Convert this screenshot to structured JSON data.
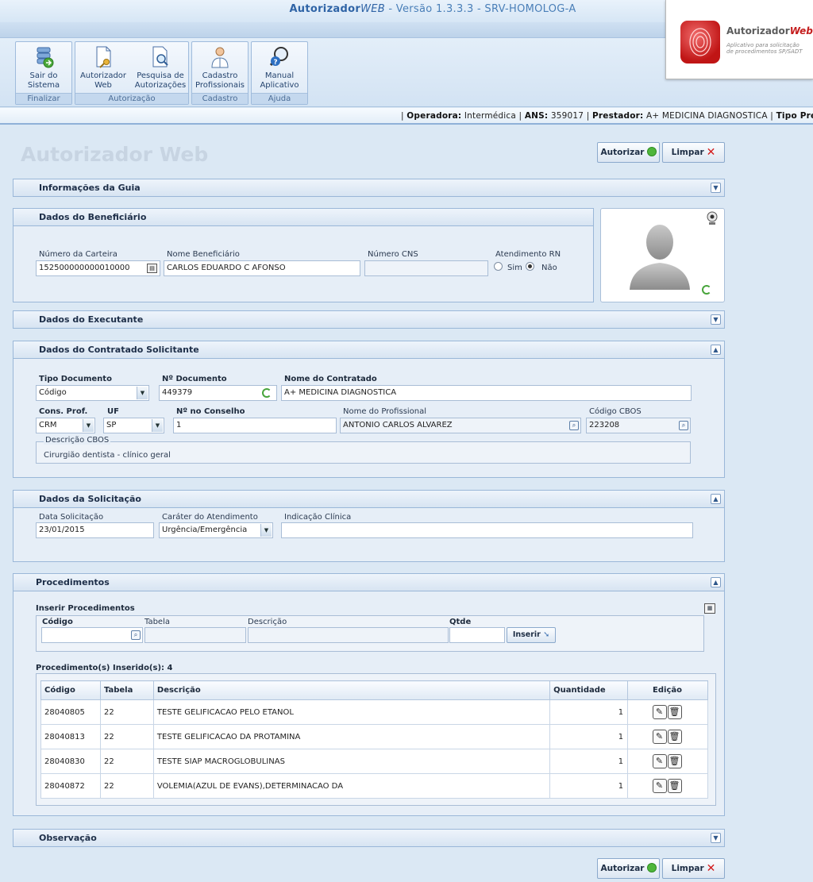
{
  "header": {
    "app_name_bold": "Autorizador",
    "app_name_italic": "WEB",
    "version_text": " - Versão 1.3.3.3 - SRV-HOMOLOG-A"
  },
  "ribbon": {
    "groups": [
      {
        "caption": "Finalizar",
        "buttons": [
          {
            "label": "Sair do Sistema",
            "icon": "exit-system-icon"
          }
        ]
      },
      {
        "caption": "Autorização",
        "buttons": [
          {
            "label": "Autorizador Web",
            "icon": "document-key-icon"
          },
          {
            "label": "Pesquisa de Autorizações",
            "icon": "document-search-icon"
          }
        ]
      },
      {
        "caption": "Cadastro",
        "buttons": [
          {
            "label": "Cadastro Profissionais",
            "icon": "doctor-icon"
          }
        ]
      },
      {
        "caption": "Ajuda",
        "buttons": [
          {
            "label": "Manual Aplicativo",
            "icon": "help-search-icon"
          }
        ]
      }
    ]
  },
  "logo": {
    "name": "Autorizador",
    "name_italic": "Web",
    "tagline": "Aplicativo para solicitação de procedimentos SP/SADT"
  },
  "info_bar": {
    "operadora_label": "Operadora:",
    "operadora": "Intermédica",
    "ans_label": "ANS:",
    "ans": "359017",
    "prestador_label": "Prestador:",
    "prestador": "A+ MEDICINA DIAGNOSTICA",
    "tipo_label": "Tipo Prestad"
  },
  "page": {
    "title": "Autorizador Web",
    "autorizar_label": "Autorizar",
    "limpar_label": "Limpar"
  },
  "sections": {
    "guia": "Informações da Guia",
    "beneficiario": "Dados do Beneficiário",
    "executante": "Dados do Executante",
    "contratado": "Dados do Contratado Solicitante",
    "solicitacao": "Dados da Solicitação",
    "procedimentos": "Procedimentos",
    "observacao": "Observação"
  },
  "beneficiario": {
    "carteira_label": "Número da Carteira",
    "carteira_value": "152500000000010000",
    "nome_label": "Nome Beneficiário",
    "nome_value": "CARLOS EDUARDO C AFONSO",
    "cns_label": "Número CNS",
    "cns_value": "",
    "rn_label": "Atendimento RN",
    "rn_sim": "Sim",
    "rn_nao": "Não",
    "rn_selected": "Não"
  },
  "contratado": {
    "tipo_doc_label": "Tipo Documento",
    "tipo_doc_value": "Código",
    "num_doc_label": "Nº Documento",
    "num_doc_value": "449379",
    "nome_label": "Nome do Contratado",
    "nome_value": "A+ MEDICINA DIAGNOSTICA",
    "cons_label": "Cons. Prof.",
    "cons_value": "CRM",
    "uf_label": "UF",
    "uf_value": "SP",
    "conselho_label": "Nº no Conselho",
    "conselho_value": "1",
    "profissional_label": "Nome do Profissional",
    "profissional_value": "ANTONIO CARLOS ALVAREZ",
    "cbos_label": "Código CBOS",
    "cbos_value": "223208",
    "desc_cbos_label": "Descrição CBOS",
    "desc_cbos_value": "Cirurgião dentista - clínico geral"
  },
  "solicitacao": {
    "data_label": "Data Solicitação",
    "data_value": "23/01/2015",
    "carater_label": "Caráter do Atendimento",
    "carater_value": "Urgência/Emergência",
    "indicacao_label": "Indicação Clínica",
    "indicacao_value": ""
  },
  "procedimentos": {
    "inserir_title": "Inserir Procedimentos",
    "codigo_label": "Código",
    "tabela_label": "Tabela",
    "descricao_label": "Descrição",
    "qtde_label": "Qtde",
    "inserir_button": "Inserir",
    "inseridos_label": "Procedimento(s) Inserido(s):",
    "inseridos_count": "4",
    "columns": [
      "Código",
      "Tabela",
      "Descrição",
      "Quantidade",
      "Edição"
    ],
    "rows": [
      {
        "codigo": "28040805",
        "tabela": "22",
        "descricao": "TESTE GELIFICACAO PELO ETANOL",
        "quantidade": "1"
      },
      {
        "codigo": "28040813",
        "tabela": "22",
        "descricao": "TESTE GELIFICACAO DA PROTAMINA",
        "quantidade": "1"
      },
      {
        "codigo": "28040830",
        "tabela": "22",
        "descricao": "TESTE SIAP MACROGLOBULINAS",
        "quantidade": "1"
      },
      {
        "codigo": "28040872",
        "tabela": "22",
        "descricao": "VOLEMIA(AZUL DE EVANS),DETERMINACAO DA",
        "quantidade": "1"
      }
    ]
  }
}
